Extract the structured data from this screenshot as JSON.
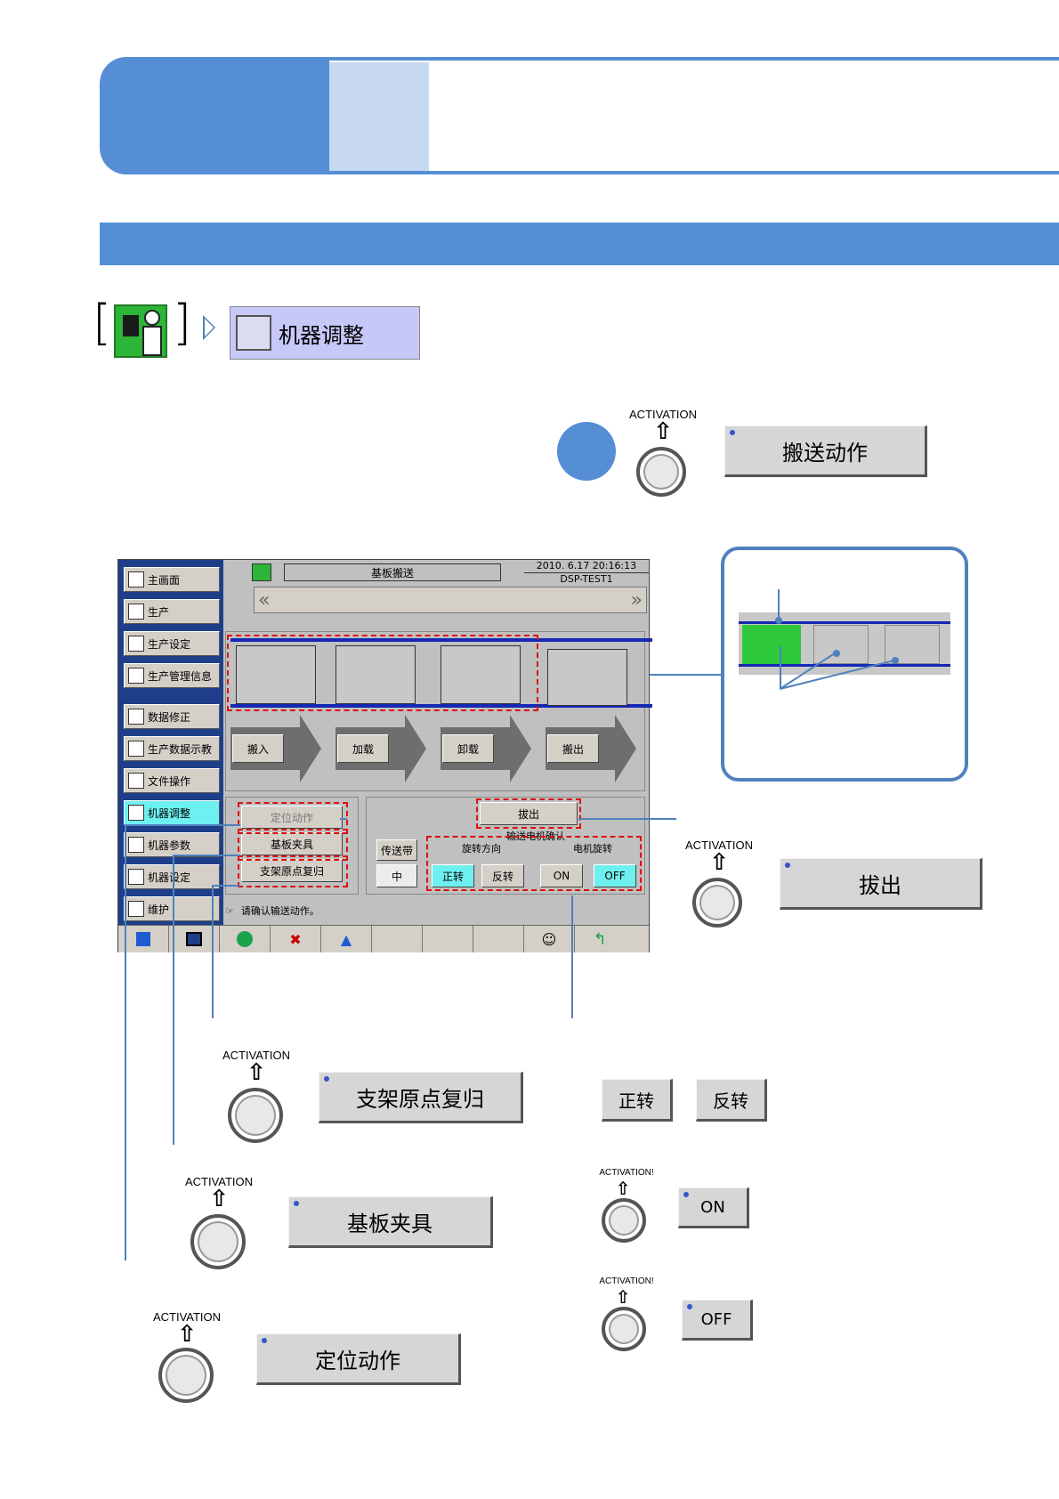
{
  "breadcrumb": {
    "machine_adjust": "机器调整"
  },
  "step_marker": "",
  "activation_label": "ACTIVATION",
  "activation_label_small": "ACTIVATION!",
  "buttons": {
    "transfer": "搬送动作",
    "eject": "拔出",
    "holder_return": "支架原点复归",
    "board_clamp": "基板夹具",
    "position_action": "定位动作",
    "forward": "正转",
    "reverse": "反转",
    "on": "ON",
    "off": "OFF"
  },
  "screen": {
    "title": "基板搬送",
    "datetime": "2010. 6.17 20:16:13",
    "machine": "DSP-TEST1",
    "sidebar": [
      "主画面",
      "生产",
      "生产设定",
      "生产管理信息",
      "数据修正",
      "生产数据示教",
      "文件操作",
      "机器调整",
      "机器参数",
      "机器设定",
      "维护"
    ],
    "stages": [
      "搬入",
      "加载",
      "卸载",
      "搬出"
    ],
    "left_panel": [
      "定位动作",
      "基板夹具",
      "支架原点复归"
    ],
    "eject": "拔出",
    "motor_confirm": "输送电机确认",
    "conveyor_label": "传送带",
    "conveyor_value": "中",
    "rotation_dir": "旋转方向",
    "motor_rotation": "电机旋转",
    "forward": "正转",
    "reverse": "反转",
    "on": "ON",
    "off": "OFF",
    "status": "请确认输送动作。"
  }
}
